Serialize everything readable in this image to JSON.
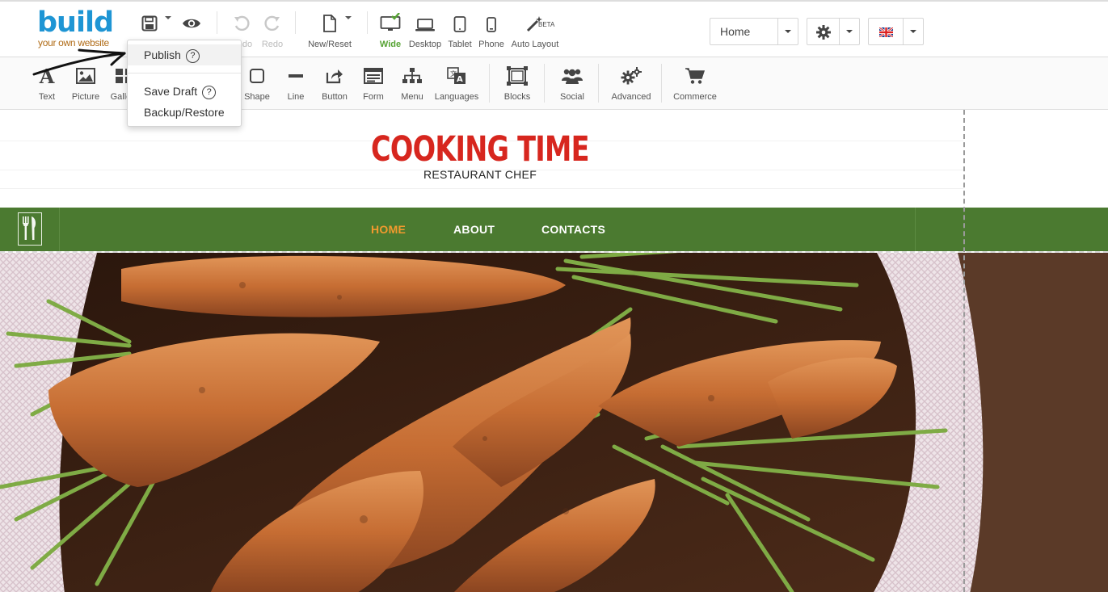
{
  "logo": {
    "main": "build",
    "sub": "your own website"
  },
  "top_toolbar": {
    "undo_label": "Undo",
    "redo_label": "Redo",
    "new_reset_label": "New/Reset",
    "views": [
      {
        "label": "Wide",
        "icon": "monitor-icon",
        "active": true
      },
      {
        "label": "Desktop",
        "icon": "laptop-icon"
      },
      {
        "label": "Tablet",
        "icon": "tablet-icon"
      },
      {
        "label": "Phone",
        "icon": "phone-icon"
      },
      {
        "label": "Auto Layout",
        "icon": "magic-wand-icon",
        "badge": "BETA"
      }
    ],
    "page_select": "Home",
    "language_flag": "UK"
  },
  "save_menu": {
    "items": [
      {
        "label": "Publish",
        "help": "?"
      },
      {
        "label": "Save Draft",
        "help": "?"
      },
      {
        "label": "Backup/Restore"
      }
    ]
  },
  "tools": [
    {
      "label": "Text",
      "icon": "text-icon"
    },
    {
      "label": "Picture",
      "icon": "picture-icon"
    },
    {
      "label": "Gallery",
      "icon": "gallery-icon"
    },
    {
      "label": "Shape",
      "icon": "shape-icon"
    },
    {
      "label": "Line",
      "icon": "line-icon"
    },
    {
      "label": "Button",
      "icon": "button-share-icon"
    },
    {
      "label": "Form",
      "icon": "form-icon"
    },
    {
      "label": "Menu",
      "icon": "sitemap-icon"
    },
    {
      "label": "Languages",
      "icon": "languages-icon"
    },
    {
      "label": "Blocks",
      "icon": "blocks-icon"
    },
    {
      "label": "Social",
      "icon": "users-icon"
    },
    {
      "label": "Advanced",
      "icon": "gears-icon"
    },
    {
      "label": "Commerce",
      "icon": "cart-icon"
    }
  ],
  "site": {
    "title": "COOKING TIME",
    "subtitle": "RESTAURANT CHEF",
    "nav": [
      {
        "label": "HOME",
        "active": true
      },
      {
        "label": "ABOUT"
      },
      {
        "label": "CONTACTS"
      }
    ],
    "hero_image": "carrots-photo"
  },
  "colors": {
    "logo_blue": "#1e95d4",
    "logo_sub": "#b06b16",
    "brand_red": "#d7261e",
    "nav_green": "#4b7a30",
    "nav_active": "#f29a2e",
    "view_active": "#56a333"
  }
}
